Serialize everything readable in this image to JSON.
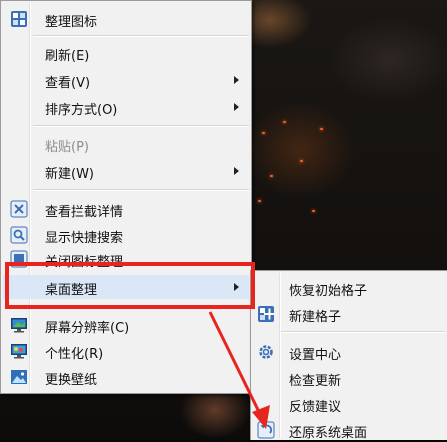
{
  "colors": {
    "menu_bg": "#f1f1f1",
    "highlight": "#d9e7f7",
    "annotation_red": "#e8241f",
    "icon_blue": "#3b6fb6"
  },
  "context_menu": {
    "items": [
      {
        "label": "整理图标",
        "icon": "organize-icons-icon"
      },
      {
        "label": "刷新(E)"
      },
      {
        "label": "查看(V)",
        "submenu": true
      },
      {
        "label": "排序方式(O)",
        "submenu": true
      },
      {
        "label": "粘贴(P)",
        "disabled": true
      },
      {
        "label": "新建(W)",
        "submenu": true
      },
      {
        "label": "查看拦截详情",
        "icon": "intercept-details-icon"
      },
      {
        "label": "显示快捷搜索",
        "icon": "quick-search-icon"
      },
      {
        "label": "关闭图标整理",
        "icon": "close-organize-icon"
      },
      {
        "label": "桌面整理",
        "submenu": true,
        "highlighted": true
      },
      {
        "label": "屏幕分辨率(C)",
        "icon": "monitor-icon"
      },
      {
        "label": "个性化(R)",
        "icon": "personalize-icon"
      },
      {
        "label": "更换壁纸",
        "icon": "wallpaper-icon"
      }
    ]
  },
  "desktop_submenu": {
    "items": [
      {
        "label": "恢复初始格子"
      },
      {
        "label": "新建格子",
        "icon": "new-grid-icon"
      },
      {
        "label": "设置中心",
        "icon": "gear-icon"
      },
      {
        "label": "检查更新"
      },
      {
        "label": "反馈建议"
      },
      {
        "label": "还原系统桌面",
        "icon": "restore-icon"
      }
    ]
  }
}
